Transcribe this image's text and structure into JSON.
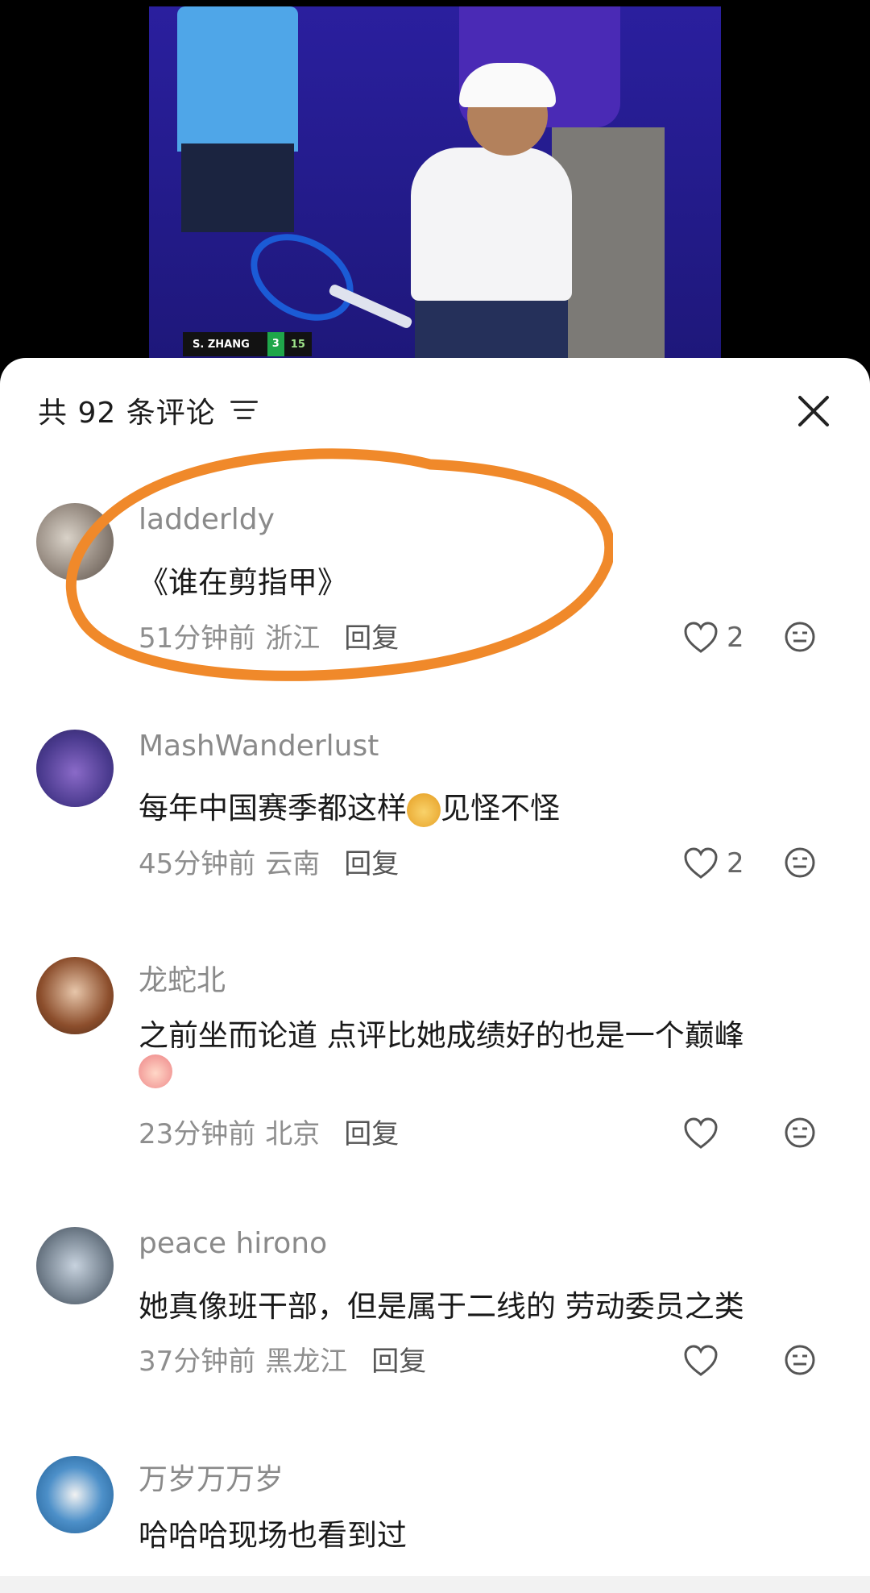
{
  "video": {
    "scoreboard": {
      "player": "S. ZHANG",
      "sets": "3",
      "games": "15"
    }
  },
  "header": {
    "title": "共 92 条评论"
  },
  "comments": [
    {
      "username": "ladderldy",
      "text": "《谁在剪指甲》",
      "time": "51分钟前",
      "location": "浙江",
      "reply": "回复",
      "likes": "2"
    },
    {
      "username": "MashWanderlust",
      "text_before": "每年中国赛季都这样",
      "text_after": "见怪不怪",
      "time": "45分钟前",
      "location": "云南",
      "reply": "回复",
      "likes": "2"
    },
    {
      "username": "龙蛇北",
      "text": "之前坐而论道 点评比她成绩好的也是一个巅峰",
      "time": "23分钟前",
      "location": "北京",
      "reply": "回复",
      "likes": ""
    },
    {
      "username": "peace hirono",
      "text": "她真像班干部，但是属于二线的 劳动委员之类",
      "time": "37分钟前",
      "location": "黑龙江",
      "reply": "回复",
      "likes": ""
    },
    {
      "username": "万岁万万岁",
      "text": "哈哈哈现场也看到过"
    }
  ],
  "icons": {
    "like": "heart-outline-icon",
    "dislike": "neutral-face-icon",
    "filter": "filter-lines-icon",
    "close": "close-icon"
  },
  "colors": {
    "highlight": "#f0892a",
    "text": "#1a1a1a",
    "meta": "#8e8e8e"
  }
}
